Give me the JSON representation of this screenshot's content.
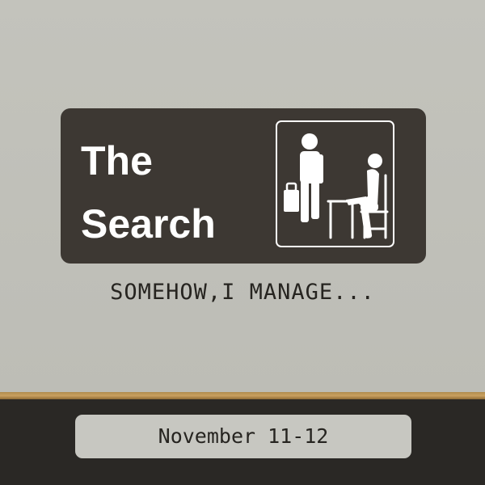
{
  "sign": {
    "title_line1": "The",
    "title_line2": "Search",
    "pictogram": "person-with-briefcase-and-seated-interviewer-icon"
  },
  "tagline": "SOMEHOW,I MANAGE...",
  "date": "November 11-12",
  "colors": {
    "wall": "#c0c0b9",
    "sign_background": "#3d3833",
    "sign_text": "#ffffff",
    "ledge": "#c9a060",
    "floor": "#2a2825",
    "date_pill": "#c7c7c1",
    "text_dark": "#262420"
  }
}
